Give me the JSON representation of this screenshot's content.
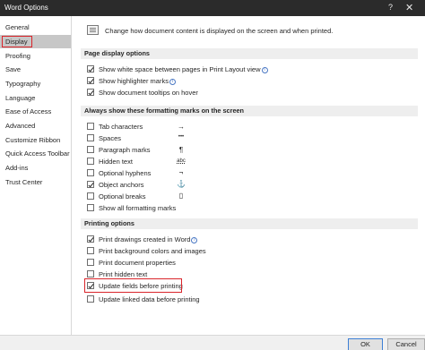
{
  "window": {
    "title": "Word Options",
    "help_label": "?",
    "close_label": "✕"
  },
  "sidebar": {
    "items": [
      {
        "label": "General"
      },
      {
        "label": "Display"
      },
      {
        "label": "Proofing"
      },
      {
        "label": "Save"
      },
      {
        "label": "Typography"
      },
      {
        "label": "Language"
      },
      {
        "label": "Ease of Access"
      },
      {
        "label": "Advanced"
      },
      {
        "label": "Customize Ribbon"
      },
      {
        "label": "Quick Access Toolbar"
      },
      {
        "label": "Add-ins"
      },
      {
        "label": "Trust Center"
      }
    ],
    "selected": "Display"
  },
  "intro": {
    "text": "Change how document content is displayed on the screen and when printed."
  },
  "sections": {
    "page_display": {
      "header": "Page display options",
      "options": [
        {
          "label": "Show white space between pages in Print Layout view",
          "checked": true
        },
        {
          "label": "Show highlighter marks",
          "checked": true
        },
        {
          "label": "Show document tooltips on hover",
          "checked": true
        }
      ]
    },
    "formatting_marks": {
      "header": "Always show these formatting marks on the screen",
      "options": [
        {
          "label": "Tab characters",
          "checked": false,
          "symbol": "→"
        },
        {
          "label": "Spaces",
          "checked": false,
          "symbol": "•••"
        },
        {
          "label": "Paragraph marks",
          "checked": false,
          "symbol": "¶"
        },
        {
          "label": "Hidden text",
          "checked": false,
          "symbol": "abc"
        },
        {
          "label": "Optional hyphens",
          "checked": false,
          "symbol": "¬"
        },
        {
          "label": "Object anchors",
          "checked": true,
          "symbol": "⚓"
        },
        {
          "label": "Optional breaks",
          "checked": false,
          "symbol": "▯"
        },
        {
          "label": "Show all formatting marks",
          "checked": false
        }
      ]
    },
    "printing": {
      "header": "Printing options",
      "options": [
        {
          "label": "Print drawings created in Word",
          "checked": true
        },
        {
          "label": "Print background colors and images",
          "checked": false
        },
        {
          "label": "Print document properties",
          "checked": false
        },
        {
          "label": "Print hidden text",
          "checked": false
        },
        {
          "label": "Update fields before printing",
          "checked": true
        },
        {
          "label": "Update linked data before printing",
          "checked": false
        }
      ]
    }
  },
  "footer": {
    "ok_label": "OK",
    "cancel_label": "Cancel"
  },
  "colors": {
    "titlebar": "#2b2b2b",
    "highlight_box": "#d9242a",
    "selected_nav": "#c7c7c7",
    "section_header_bg": "#eeeeee"
  }
}
